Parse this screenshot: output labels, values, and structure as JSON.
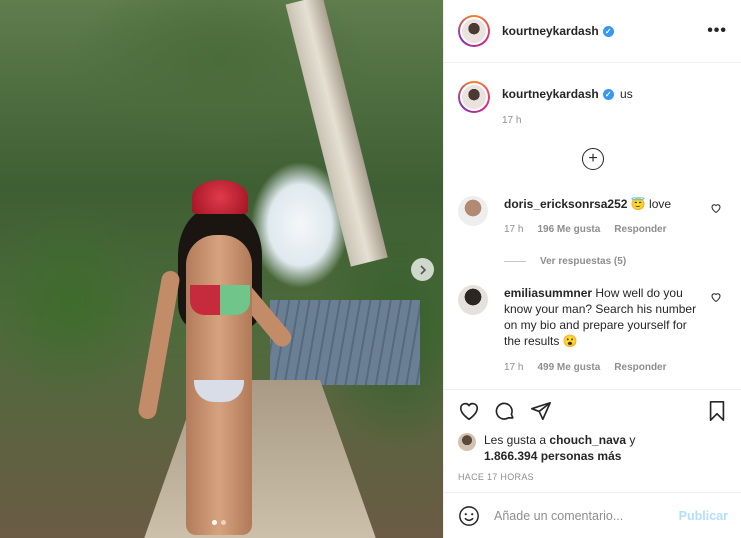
{
  "post": {
    "username": "kourtneykardash",
    "verified_mark": "✓",
    "more_icon": "more-horizontal-icon"
  },
  "caption": {
    "username": "kourtneykardash",
    "text": "us",
    "time": "17 h"
  },
  "comments": [
    {
      "username": "doris_ericksonrsa252",
      "text": "😇 love",
      "time": "17 h",
      "likes": "196 Me gusta",
      "reply": "Responder",
      "view_replies": "Ver respuestas (5)"
    },
    {
      "username": "emiliasummner",
      "text": "How well do you know your man? Search his number on my bio and prepare yourself for the results 😮",
      "time": "17 h",
      "likes": "499 Me gusta",
      "reply": "Responder"
    }
  ],
  "likes_info": {
    "prefix": "Les gusta a ",
    "user": "chouch_nava",
    "middle": " y",
    "count": "1.866.394 personas más"
  },
  "posted_ago": "HACE 17 HORAS",
  "add_comment": {
    "placeholder": "Añade un comentario...",
    "publish": "Publicar"
  },
  "carousel": {
    "total": 2,
    "active": 1
  },
  "colors": {
    "verified": "#3897f0",
    "publish_disabled": "#b2dffc",
    "muted": "#8e8e8e"
  }
}
